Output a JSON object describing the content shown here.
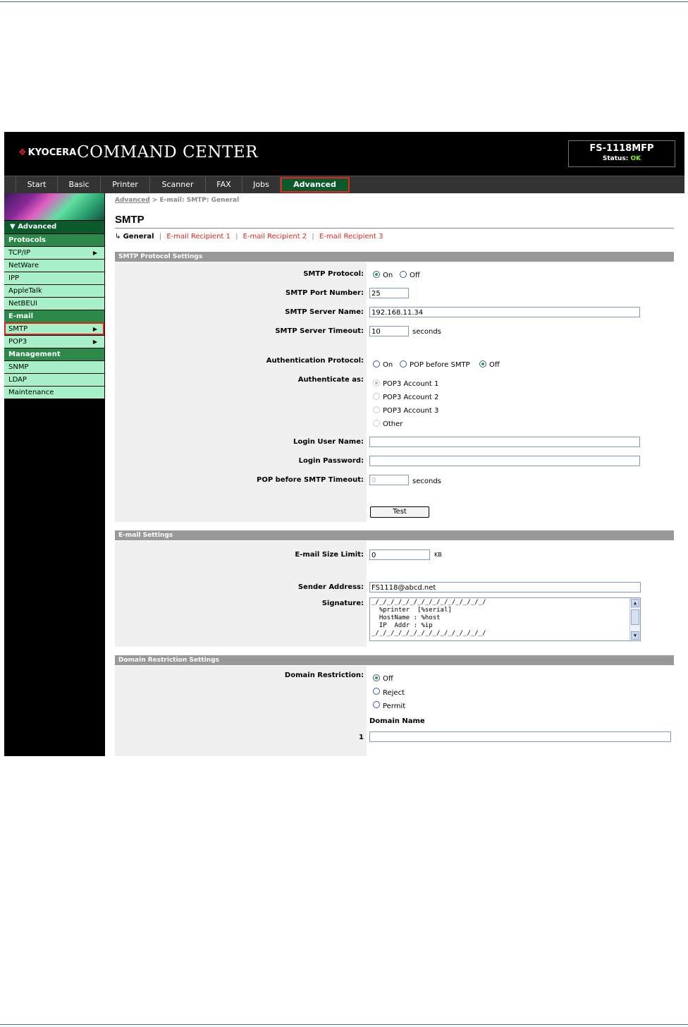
{
  "header": {
    "logo_text": "KYOCERA",
    "app_title": "COMMAND CENTER",
    "model": "FS-1118MFP",
    "status_label": "Status:",
    "status_value": "OK"
  },
  "tabs": [
    {
      "label": "Start"
    },
    {
      "label": "Basic"
    },
    {
      "label": "Printer"
    },
    {
      "label": "Scanner"
    },
    {
      "label": "FAX"
    },
    {
      "label": "Jobs"
    },
    {
      "label": "Advanced"
    }
  ],
  "sidebar": {
    "section_title": "Advanced",
    "groups": [
      {
        "heading": "Protocols",
        "items": [
          "TCP/IP",
          "NetWare",
          "IPP",
          "AppleTalk",
          "NetBEUI"
        ]
      },
      {
        "heading": "E-mail",
        "items": [
          "SMTP",
          "POP3"
        ]
      },
      {
        "heading": "Management",
        "items": [
          "SNMP",
          "LDAP",
          "Maintenance"
        ]
      }
    ]
  },
  "breadcrumb": {
    "root": "Advanced",
    "separator": ">",
    "current": "E-mail: SMTP: General"
  },
  "page_title": "SMTP",
  "subnav": {
    "current": "General",
    "links": [
      "E-mail Recipient 1",
      "E-mail Recipient 2",
      "E-mail Recipient 3"
    ],
    "separator": "|"
  },
  "smtp_section": {
    "title": "SMTP Protocol Settings",
    "protocol_label": "SMTP Protocol:",
    "protocol_on": "On",
    "protocol_off": "Off",
    "port_label": "SMTP Port Number:",
    "port_value": "25",
    "server_label": "SMTP Server Name:",
    "server_value": "192.168.11.34",
    "timeout_label": "SMTP Server Timeout:",
    "timeout_value": "10",
    "timeout_unit": "seconds",
    "auth_label": "Authentication Protocol:",
    "auth_on": "On",
    "auth_pop": "POP before SMTP",
    "auth_off": "Off",
    "authas_label": "Authenticate as:",
    "authas_options": [
      "POP3 Account 1",
      "POP3 Account 2",
      "POP3 Account 3",
      "Other"
    ],
    "login_user_label": "Login User Name:",
    "login_user_value": "",
    "login_pass_label": "Login Password:",
    "login_pass_value": "",
    "pop_timeout_label": "POP before SMTP Timeout:",
    "pop_timeout_value": "0",
    "pop_timeout_unit": "seconds",
    "test_button": "Test"
  },
  "email_section": {
    "title": "E-mail Settings",
    "size_label": "E-mail Size Limit:",
    "size_value": "0",
    "size_unit": "KB",
    "sender_label": "Sender Address:",
    "sender_value": "FS1118@abcd.net",
    "signature_label": "Signature:",
    "signature_lines": [
      "_/_/_/_/_/_/_/_/_/_/_/_/_/_/_/",
      "  %printer  [%serial]",
      "  HostName : %host",
      "  IP  Addr : %ip",
      "_/_/_/_/_/_/_/_/_/_/_/_/_/_/_/"
    ]
  },
  "domain_section": {
    "title": "Domain Restriction Settings",
    "restriction_label": "Domain Restriction:",
    "options": [
      "Off",
      "Reject",
      "Permit"
    ],
    "domain_name_heading": "Domain Name",
    "row_number": "1",
    "row_value": ""
  },
  "colors": {
    "brand_red": "#e2231a",
    "active_tab": "#0a5a2c",
    "menu_item": "#a8f0c8",
    "menu_heading": "#2b8a4a",
    "status_ok": "#7cfc00"
  }
}
